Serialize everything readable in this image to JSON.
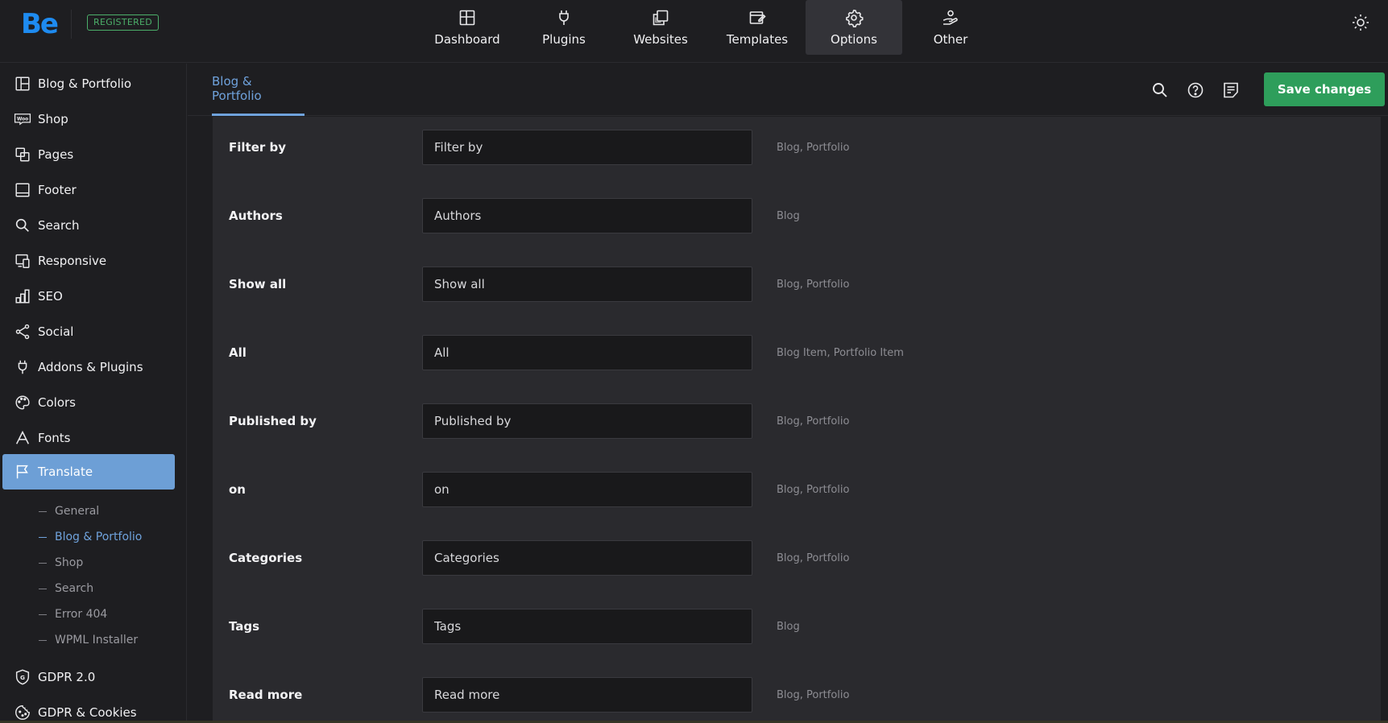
{
  "brand": {
    "logo_text": "Be",
    "badge": "REGISTERED"
  },
  "topnav": [
    {
      "label": "Dashboard",
      "icon": "dashboard-icon"
    },
    {
      "label": "Plugins",
      "icon": "plug-icon"
    },
    {
      "label": "Websites",
      "icon": "websites-icon"
    },
    {
      "label": "Templates",
      "icon": "templates-icon"
    },
    {
      "label": "Options",
      "icon": "gear-icon",
      "active": true
    },
    {
      "label": "Other",
      "icon": "hand-icon"
    }
  ],
  "sidebar": {
    "items": [
      {
        "label": "Blog & Portfolio",
        "icon": "layout-icon"
      },
      {
        "label": "Shop",
        "icon": "woo-icon"
      },
      {
        "label": "Pages",
        "icon": "pages-icon"
      },
      {
        "label": "Footer",
        "icon": "footer-icon"
      },
      {
        "label": "Search",
        "icon": "search-icon"
      },
      {
        "label": "Responsive",
        "icon": "responsive-icon"
      },
      {
        "label": "SEO",
        "icon": "seo-chart-icon"
      },
      {
        "label": "Social",
        "icon": "share-icon"
      },
      {
        "label": "Addons & Plugins",
        "icon": "plug-icon"
      },
      {
        "label": "Colors",
        "icon": "palette-icon"
      },
      {
        "label": "Fonts",
        "icon": "font-icon"
      },
      {
        "label": "Translate",
        "icon": "flag-icon",
        "active": true
      }
    ],
    "sub_items": [
      {
        "label": "General"
      },
      {
        "label": "Blog & Portfolio",
        "active": true
      },
      {
        "label": "Shop"
      },
      {
        "label": "Search"
      },
      {
        "label": "Error 404"
      },
      {
        "label": "WPML Installer"
      }
    ],
    "bottom_items": [
      {
        "label": "GDPR 2.0",
        "icon": "gdpr-shield-icon"
      },
      {
        "label": "GDPR & Cookies",
        "icon": "cookie-icon"
      }
    ]
  },
  "header": {
    "tab": "Blog & Portfolio",
    "save_label": "Save changes",
    "icons": [
      "search-icon",
      "help-icon",
      "notes-icon"
    ]
  },
  "fields": [
    {
      "label": "Filter by",
      "value": "Filter by",
      "hint": "Blog, Portfolio"
    },
    {
      "label": "Authors",
      "value": "Authors",
      "hint": "Blog"
    },
    {
      "label": "Show all",
      "value": "Show all",
      "hint": "Blog, Portfolio"
    },
    {
      "label": "All",
      "value": "All",
      "hint": "Blog Item, Portfolio Item"
    },
    {
      "label": "Published by",
      "value": "Published by",
      "hint": "Blog, Portfolio"
    },
    {
      "label": "on",
      "value": "on",
      "hint": "Blog, Portfolio"
    },
    {
      "label": "Categories",
      "value": "Categories",
      "hint": "Blog, Portfolio"
    },
    {
      "label": "Tags",
      "value": "Tags",
      "hint": "Blog"
    },
    {
      "label": "Read more",
      "value": "Read more",
      "hint": "Blog, Portfolio"
    }
  ],
  "colors": {
    "accent": "#6fa2dc",
    "save": "#2e9e5b",
    "logo": "#1e8bf0",
    "badge": "#4caf6a"
  }
}
